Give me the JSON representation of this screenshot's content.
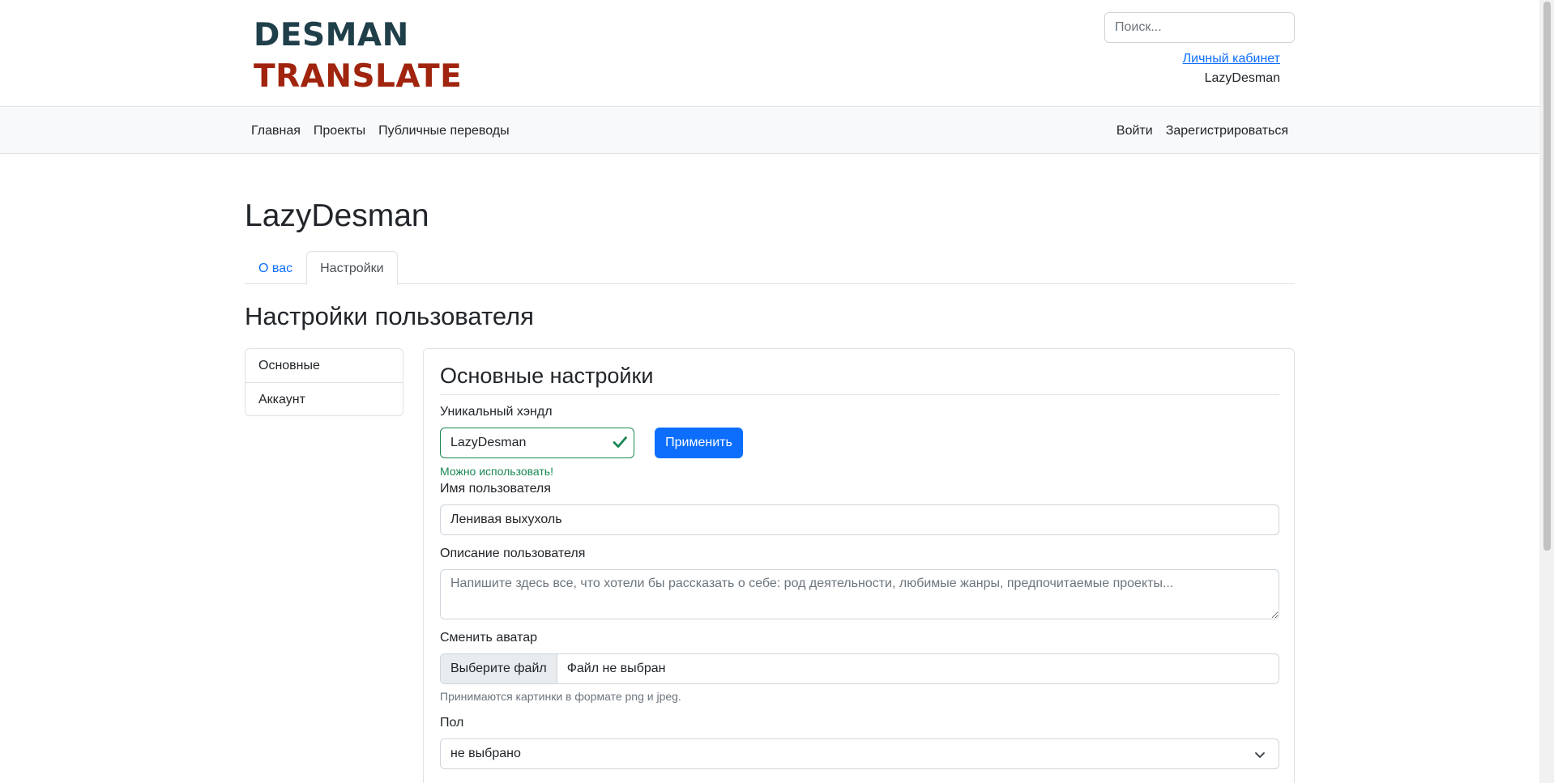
{
  "header": {
    "logo_line1": "DESMAN",
    "logo_line2": "TRANSLATE",
    "search_placeholder": "Поиск...",
    "cabinet_link": "Личный кабинет",
    "username": "LazyDesman"
  },
  "navbar": {
    "left": [
      "Главная",
      "Проекты",
      "Публичные переводы"
    ],
    "right": [
      "Войти",
      "Зарегистрироваться"
    ]
  },
  "page": {
    "title": "LazyDesman",
    "tabs": [
      "О вас",
      "Настройки"
    ],
    "active_tab": "Настройки",
    "section_title": "Настройки пользователя"
  },
  "sidebar": {
    "items": [
      "Основные",
      "Аккаунт"
    ]
  },
  "form": {
    "title": "Основные настройки",
    "handle_label": "Уникальный хэндл",
    "handle_value": "LazyDesman",
    "apply_button": "Применить",
    "handle_valid": "Можно использовать!",
    "name_label": "Имя пользователя",
    "name_value": "Ленивая выхухоль",
    "description_label": "Описание пользователя",
    "description_placeholder": "Напишите здесь все, что хотели бы рассказать о себе: род деятельности, любимые жанры, предпочитаемые проекты...",
    "avatar_label": "Сменить аватар",
    "file_button": "Выберите файл",
    "file_status": "Файл не выбран",
    "avatar_help": "Принимаются картинки в формате png и jpeg.",
    "gender_label": "Пол",
    "gender_value": "не выбрано"
  },
  "colors": {
    "primary": "#0d6efd",
    "success": "#198754",
    "logo_dark": "#1f3f4a",
    "logo_red": "#a0240e"
  }
}
